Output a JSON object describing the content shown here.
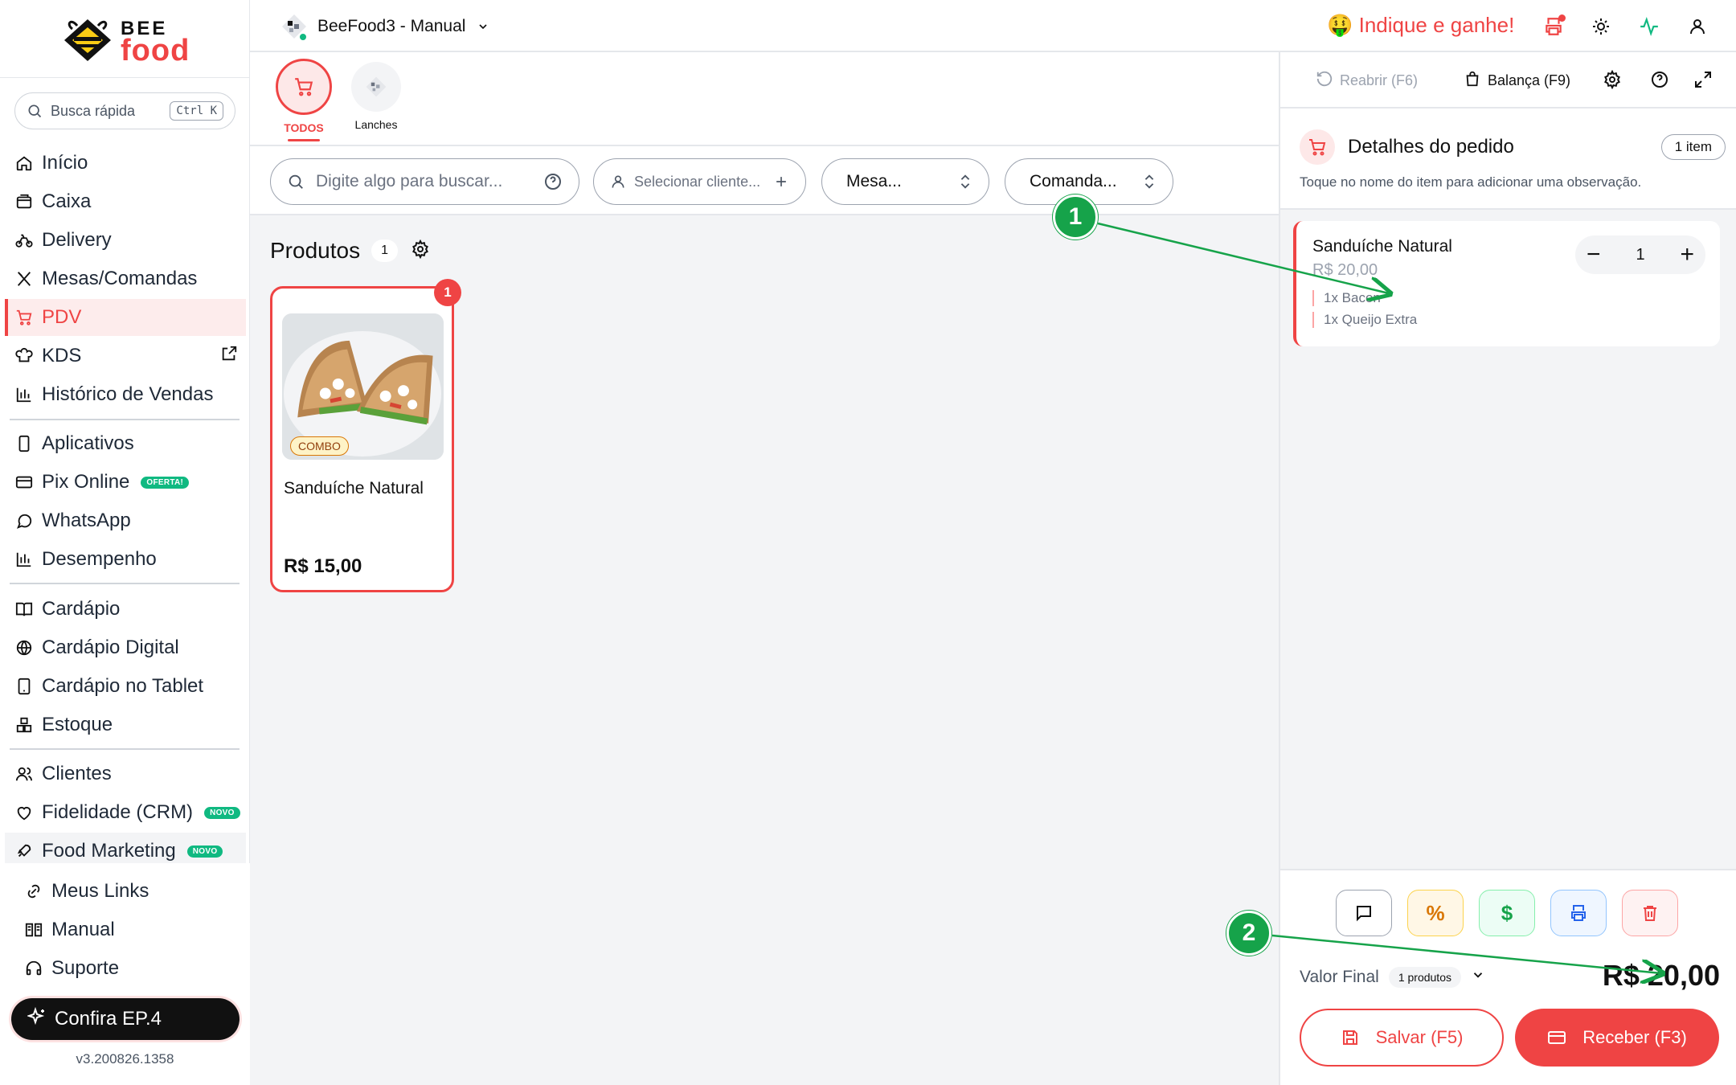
{
  "brand": {
    "line1": "BEE",
    "line2": "food"
  },
  "sidebar": {
    "search": {
      "placeholder": "Busca rápida",
      "shortcut": "Ctrl K"
    },
    "items": [
      {
        "label": "Início",
        "icon": "home-icon"
      },
      {
        "label": "Caixa",
        "icon": "cash-register-icon"
      },
      {
        "label": "Delivery",
        "icon": "bike-icon"
      },
      {
        "label": "Mesas/Comandas",
        "icon": "utensils-icon"
      },
      {
        "label": "PDV",
        "icon": "cart-icon",
        "active": true
      },
      {
        "label": "KDS",
        "icon": "chef-hat-icon",
        "external": true
      },
      {
        "label": "Histórico de Vendas",
        "icon": "bar-chart-icon"
      },
      {
        "label": "Aplicativos",
        "icon": "smartphone-icon"
      },
      {
        "label": "Pix Online",
        "icon": "credit-card-icon",
        "badge": "OFERTA!"
      },
      {
        "label": "WhatsApp",
        "icon": "chat-bubble-icon"
      },
      {
        "label": "Desempenho",
        "icon": "bar-chart-icon"
      },
      {
        "label": "Cardápio",
        "icon": "book-open-icon"
      },
      {
        "label": "Cardápio Digital",
        "icon": "globe-icon"
      },
      {
        "label": "Cardápio no Tablet",
        "icon": "tablet-icon"
      },
      {
        "label": "Estoque",
        "icon": "boxes-icon"
      },
      {
        "label": "Clientes",
        "icon": "users-icon"
      },
      {
        "label": "Fidelidade (CRM)",
        "icon": "heart-icon",
        "badge": "NOVO"
      },
      {
        "label": "Food Marketing",
        "icon": "rocket-icon",
        "badge": "NOVO"
      }
    ],
    "bottom_items": [
      {
        "label": "Meus Links",
        "icon": "link-icon"
      },
      {
        "label": "Manual",
        "icon": "book-icon"
      },
      {
        "label": "Suporte",
        "icon": "headphones-icon"
      }
    ],
    "promo_button": "Confira EP.4",
    "version": "v3.200826.1358"
  },
  "topbar": {
    "store_name": "BeeFood3 - Manual",
    "referral": "🤑 Indique e ganhe!",
    "icons": [
      "printer-icon",
      "sun-icon",
      "activity-icon",
      "user-icon"
    ]
  },
  "categories": [
    {
      "label": "TODOS",
      "active": true
    },
    {
      "label": "Lanches",
      "active": false
    }
  ],
  "filters": {
    "search_placeholder": "Digite algo para buscar...",
    "client_placeholder": "Selecionar cliente...",
    "table_placeholder": "Mesa...",
    "tab_placeholder": "Comanda..."
  },
  "products": {
    "title": "Produtos",
    "count": "1",
    "items": [
      {
        "name": "Sanduíche Natural",
        "price": "R$ 15,00",
        "tag": "COMBO",
        "qty_badge": "1"
      }
    ]
  },
  "order_panel": {
    "reopen": "Reabrir (F6)",
    "scale": "Balança (F9)",
    "title": "Detalhes do pedido",
    "item_count": "1 item",
    "hint": "Toque no nome do item para adicionar uma observação.",
    "items": [
      {
        "name": "Sanduíche Natural",
        "price": "R$ 20,00",
        "quantity": "1",
        "addons": [
          "1x Bacon",
          "1x Queijo Extra"
        ]
      }
    ],
    "actions": [
      "comment-icon",
      "%",
      "$",
      "printer-icon",
      "trash-icon"
    ],
    "final_label": "Valor Final",
    "products_count": "1 produtos",
    "total": "R$ 20,00",
    "save_label": "Salvar (F5)",
    "receive_label": "Receber (F3)"
  },
  "annotations": [
    "1",
    "2"
  ],
  "colors": {
    "accent": "#ef4444",
    "annotation": "#16a34a",
    "success": "#10b981"
  }
}
